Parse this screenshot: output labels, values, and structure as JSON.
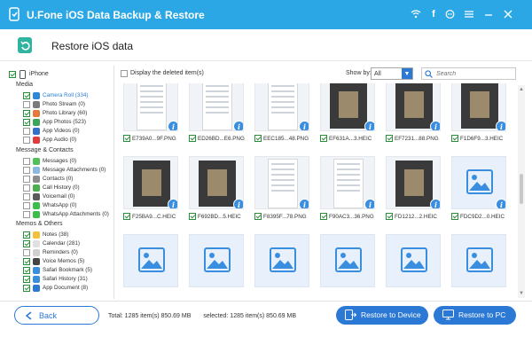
{
  "app": {
    "title": "U.Fone iOS Data Backup & Restore"
  },
  "subheader": {
    "title": "Restore iOS data"
  },
  "sidebar": {
    "root": "iPhone",
    "groups": [
      {
        "title": "Media",
        "items": [
          {
            "label": "Camera Roll (334)",
            "checked": true,
            "active": true,
            "color": "#2f87d9"
          },
          {
            "label": "Photo Stream (0)",
            "checked": false,
            "color": "#7b7b7b"
          },
          {
            "label": "Photo Library (60)",
            "checked": true,
            "color": "#e67a3a"
          },
          {
            "label": "App Photos (523)",
            "checked": true,
            "color": "#3aa65a"
          },
          {
            "label": "App Videos (0)",
            "checked": false,
            "color": "#3370c9"
          },
          {
            "label": "App Audio (0)",
            "checked": false,
            "color": "#e23b3b"
          }
        ]
      },
      {
        "title": "Message & Contacts",
        "items": [
          {
            "label": "Messages (0)",
            "checked": false,
            "color": "#52c05a"
          },
          {
            "label": "Message Attachments (0)",
            "checked": false,
            "color": "#8ab8e0"
          },
          {
            "label": "Contacts (0)",
            "checked": false,
            "color": "#8c8c8c"
          },
          {
            "label": "Call History (0)",
            "checked": false,
            "color": "#4cae4f"
          },
          {
            "label": "Voicemail (0)",
            "checked": false,
            "color": "#5b5b5b"
          },
          {
            "label": "WhatsApp (0)",
            "checked": false,
            "color": "#3cbf4a"
          },
          {
            "label": "WhatsApp Attachments (0)",
            "checked": false,
            "color": "#3cbf4a"
          }
        ]
      },
      {
        "title": "Memos & Others",
        "items": [
          {
            "label": "Notes (38)",
            "checked": true,
            "color": "#f2c23a"
          },
          {
            "label": "Calendar (281)",
            "checked": true,
            "color": "#e0e0e0"
          },
          {
            "label": "Reminders (0)",
            "checked": false,
            "color": "#d0d0d0"
          },
          {
            "label": "Voice Memos (5)",
            "checked": true,
            "color": "#444444"
          },
          {
            "label": "Safari Bookmark (5)",
            "checked": true,
            "color": "#3a8ee0"
          },
          {
            "label": "Safari History (31)",
            "checked": true,
            "color": "#3a8ee0"
          },
          {
            "label": "App Document (8)",
            "checked": true,
            "color": "#2b78d5"
          }
        ]
      }
    ]
  },
  "toolbar": {
    "show_deleted_label": "Display the deleted item(s)",
    "show_by_label": "Show by:",
    "show_by_value": "All",
    "search_placeholder": "Search"
  },
  "grid": {
    "rows": [
      [
        {
          "name": "E739A0...9F.PNG",
          "kind": "screen"
        },
        {
          "name": "ED26BD...E6.PNG",
          "kind": "screen"
        },
        {
          "name": "EEC185...48.PNG",
          "kind": "screen"
        },
        {
          "name": "EF631A...3.HEIC",
          "kind": "dark"
        },
        {
          "name": "EF7231...88.PNG",
          "kind": "dark"
        },
        {
          "name": "F1D6F9...3.HEIC",
          "kind": "dark"
        }
      ],
      [
        {
          "name": "F25BA9...C.HEIC",
          "kind": "dark"
        },
        {
          "name": "F692BD...5.HEIC",
          "kind": "dark"
        },
        {
          "name": "F8395F...78.PNG",
          "kind": "phone"
        },
        {
          "name": "F90AC3...36.PNG",
          "kind": "screen"
        },
        {
          "name": "FD1212...2.HEIC",
          "kind": "dark"
        },
        {
          "name": "FDC9D2...0.HEIC",
          "kind": "placeholder"
        }
      ],
      [
        {
          "name": "",
          "kind": "placeholder"
        },
        {
          "name": "",
          "kind": "placeholder"
        },
        {
          "name": "",
          "kind": "placeholder"
        },
        {
          "name": "",
          "kind": "placeholder"
        },
        {
          "name": "",
          "kind": "placeholder"
        },
        {
          "name": "",
          "kind": "placeholder"
        }
      ]
    ]
  },
  "footer": {
    "back_label": "Back",
    "total": "Total: 1285 item(s) 850.69 MB",
    "selected": "selected: 1285 item(s) 850.69 MB",
    "restore_device_label": "Restore to Device",
    "restore_pc_label": "Restore to PC"
  },
  "colors": {
    "accent": "#2b78d5",
    "titlebar": "#2aa7e4",
    "check": "#2a8f3b"
  }
}
